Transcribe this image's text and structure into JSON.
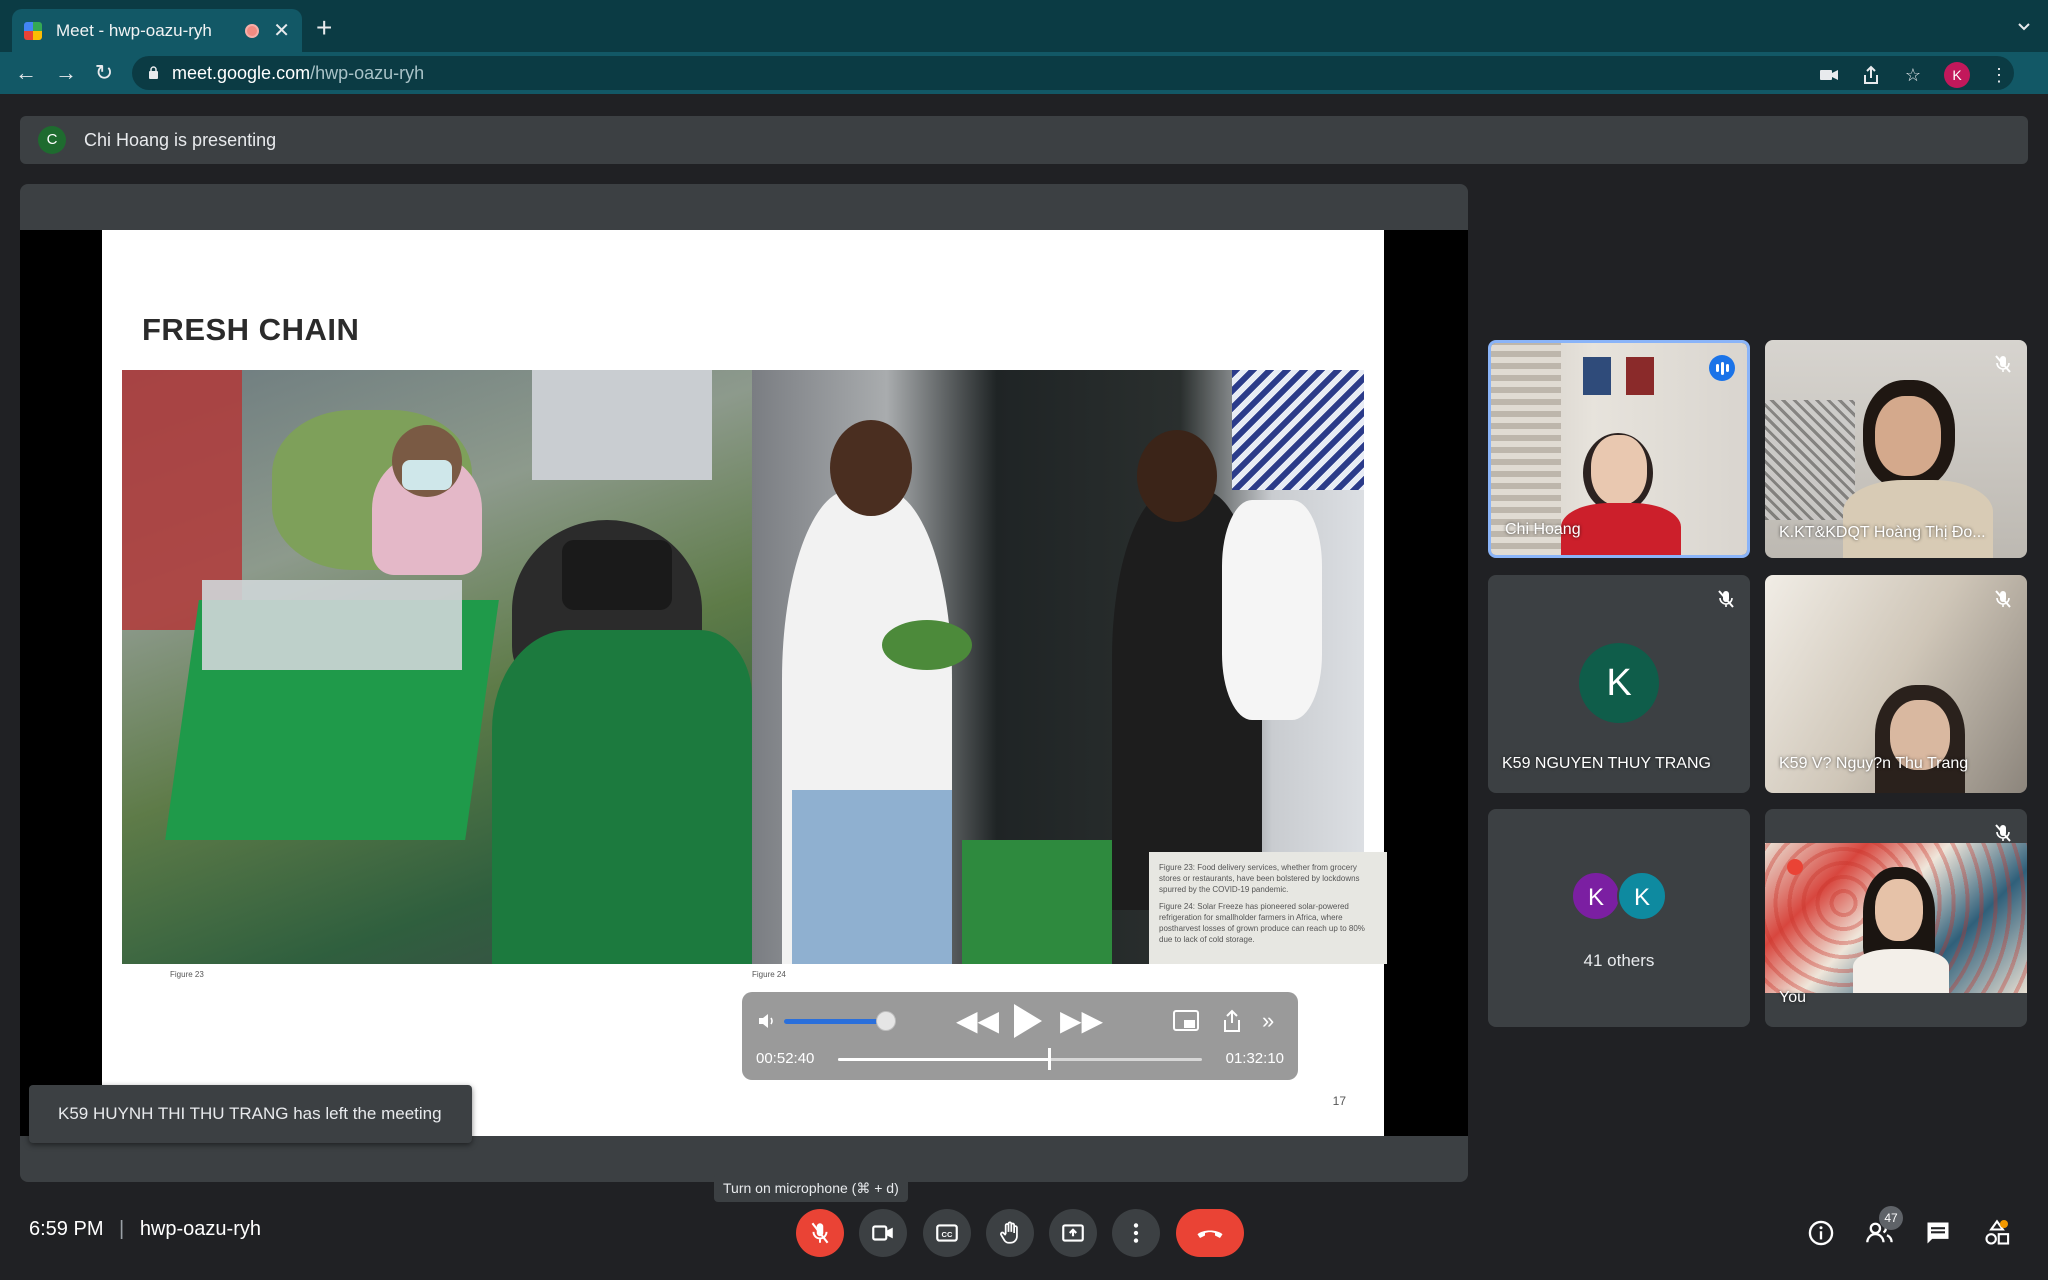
{
  "browser": {
    "tab_title": "Meet - hwp-oazu-ryh",
    "url_host": "meet.google.com",
    "url_path": "/hwp-oazu-ryh",
    "profile_initial": "K"
  },
  "presenting": {
    "avatar_initial": "C",
    "text": "Chi Hoang is presenting"
  },
  "slide": {
    "title": "FRESH CHAIN",
    "caption_1": "Figure 23: Food delivery services, whether from grocery stores or restaurants, have been bolstered by lockdowns spurred by the COVID-19 pandemic.",
    "caption_2": "Figure 24: Solar Freeze has pioneered solar-powered refrigeration for smallholder farmers in Africa, where postharvest losses of grown produce can reach up to 80% due to lack of cold storage.",
    "fig_left": "Figure 23",
    "fig_right": "Figure 24",
    "page_number": "17"
  },
  "media": {
    "current_time": "00:52:40",
    "total_time": "01:32:10",
    "volume_fraction": 0.82,
    "progress_fraction": 0.58
  },
  "toast": "K59 HUYNH THI THU TRANG has left the meeting",
  "participants": [
    {
      "name": "Chi Hoang",
      "speaking": true
    },
    {
      "name": "K.KT&KDQT Hoàng Thị Đo...",
      "muted": true
    },
    {
      "name": "K59 NGUYEN THUY TRANG",
      "initial": "K",
      "muted": true
    },
    {
      "name": "K59 V? Nguy?n Thu Trang",
      "muted": true
    },
    {
      "name": "41 others",
      "initials": [
        "K",
        "K"
      ]
    },
    {
      "name": "You",
      "muted": true
    }
  ],
  "bottom": {
    "time": "6:59 PM",
    "separator": "|",
    "meeting_code": "hwp-oazu-ryh",
    "tooltip": "Turn on microphone (⌘ + d)",
    "participant_count": "47"
  },
  "colors": {
    "end_call": "#ea4335",
    "mic_off": "#ea4335",
    "active_speaker_border": "#8ab4f8",
    "volume_track": "#2a6fdb"
  }
}
